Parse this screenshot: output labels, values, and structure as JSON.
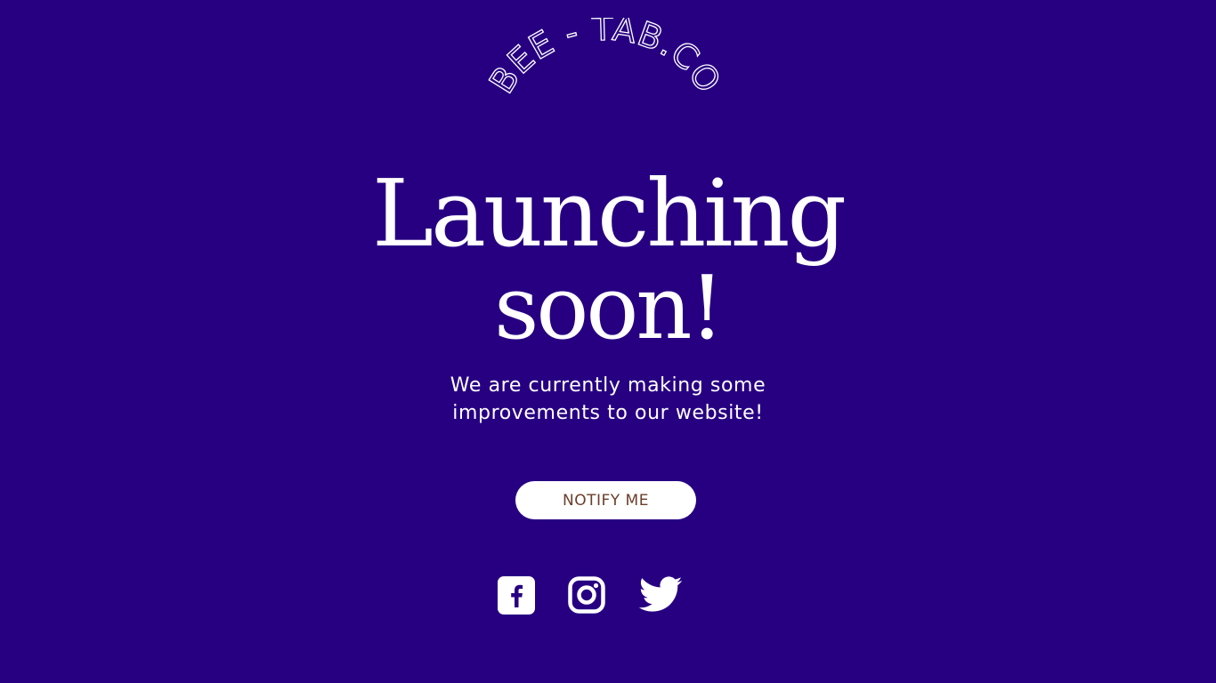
{
  "brand": {
    "logo_text": "BEE - TAB.CO"
  },
  "hero": {
    "line1": "Launching",
    "line2": "soon!"
  },
  "subtitle": {
    "line1": "We are currently making some",
    "line2": "improvements to our website!"
  },
  "cta": {
    "label": "NOTIFY ME"
  },
  "social": [
    {
      "name": "facebook",
      "icon": "facebook-icon"
    },
    {
      "name": "instagram",
      "icon": "instagram-icon"
    },
    {
      "name": "twitter",
      "icon": "twitter-icon"
    }
  ],
  "colors": {
    "background": "#270082",
    "text": "#ffffff",
    "button_bg": "#ffffff",
    "button_text": "#6b3e2a"
  }
}
